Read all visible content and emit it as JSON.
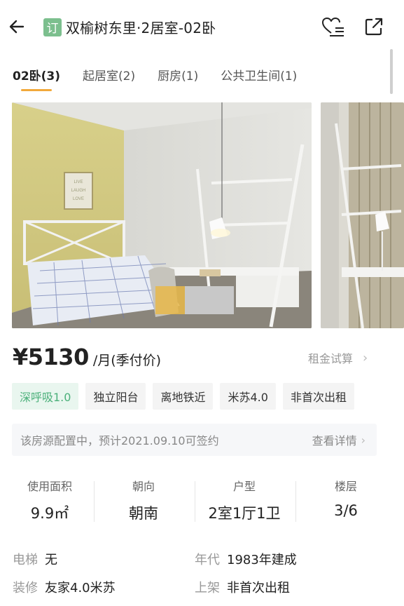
{
  "header": {
    "badge": "订",
    "title": "双榆树东里·2居室-02卧"
  },
  "tabs": [
    {
      "label": "02卧(3)",
      "active": true
    },
    {
      "label": "起居室(2)",
      "active": false
    },
    {
      "label": "厨房(1)",
      "active": false
    },
    {
      "label": "公共卫生间(1)",
      "active": false
    }
  ],
  "photo_sign": {
    "line1": "LIVE",
    "line2": "LAUGH",
    "line3": "LOVE"
  },
  "price": {
    "amount": "¥5130",
    "unit": "/月(季付价)",
    "rent_calc": "租金试算"
  },
  "tags": [
    {
      "label": "深呼吸1.0",
      "special": true
    },
    {
      "label": "独立阳台",
      "special": false
    },
    {
      "label": "离地铁近",
      "special": false
    },
    {
      "label": "米苏4.0",
      "special": false
    },
    {
      "label": "非首次出租",
      "special": false
    }
  ],
  "notice": {
    "text": "该房源配置中，预计2021.09.10可签约",
    "link": "查看详情"
  },
  "stats": [
    {
      "label": "使用面积",
      "value": "9.9㎡"
    },
    {
      "label": "朝向",
      "value": "朝南"
    },
    {
      "label": "户型",
      "value": "2室1厅1卫"
    },
    {
      "label": "楼层",
      "value": "3/6"
    }
  ],
  "details": {
    "elevator": {
      "key": "电梯",
      "value": "无"
    },
    "year": {
      "key": "年代",
      "value": "1983年建成"
    },
    "decoration": {
      "key": "装修",
      "value": "友家4.0米苏"
    },
    "listing": {
      "key": "上架",
      "value": "非首次出租"
    }
  },
  "colors": {
    "accent": "#f2a93b",
    "badge_green": "#7cbf8e",
    "tag_special_bg": "#e9f6ef",
    "tag_special_text": "#4bb07a"
  },
  "icons": [
    "back-arrow-icon",
    "favorite-compare-icon",
    "share-icon",
    "chevron-right-icon"
  ]
}
